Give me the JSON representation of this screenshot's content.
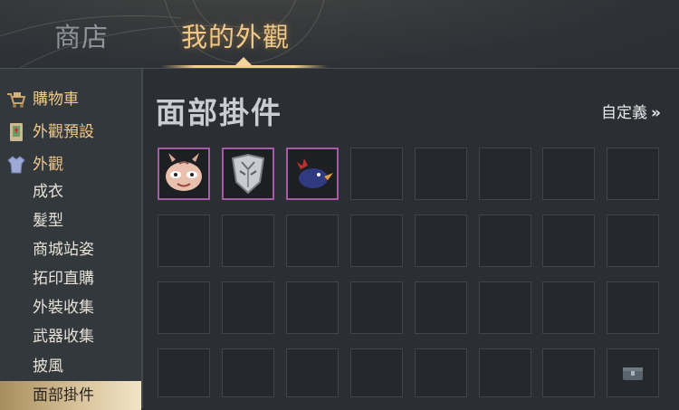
{
  "tabs": {
    "shop": "商店",
    "mine": "我的外觀"
  },
  "sidebar": {
    "items": [
      {
        "label": "購物車",
        "icon": "cart-icon",
        "category": true
      },
      {
        "label": "外觀預設",
        "icon": "preset-book-icon",
        "category": true
      },
      {
        "label": "外觀",
        "icon": "outfit-icon",
        "category": true
      },
      {
        "label": "成衣",
        "category": false
      },
      {
        "label": "髮型",
        "category": false
      },
      {
        "label": "商城站姿",
        "category": false
      },
      {
        "label": "拓印直購",
        "category": false
      },
      {
        "label": "外裝收集",
        "category": false
      },
      {
        "label": "武器收集",
        "category": false
      },
      {
        "label": "披風",
        "category": false
      },
      {
        "label": "面部掛件",
        "category": false,
        "active": true
      }
    ]
  },
  "main": {
    "title": "面部掛件",
    "custom_label": "自定義",
    "custom_chevron": "»",
    "items": [
      "dragon-mask-icon",
      "silver-mask-icon",
      "rooster-mask-icon"
    ],
    "accent": "#a55ba6"
  }
}
